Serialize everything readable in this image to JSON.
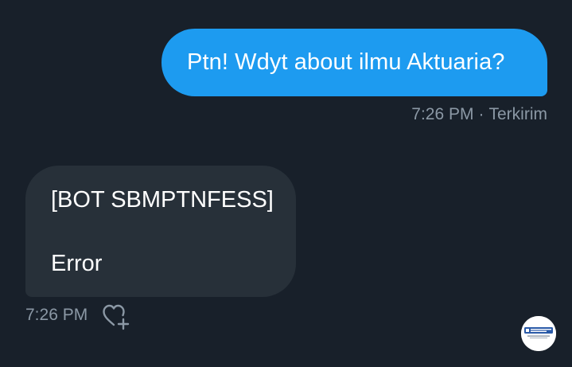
{
  "conversation": {
    "sent_message": {
      "text": "Ptn! Wdyt about ilmu Aktuaria?",
      "time": "7:26 PM",
      "separator": "·",
      "status": "Terkirim"
    },
    "received_message": {
      "line1": "[BOT SBMPTNFESS]",
      "line2": "Error",
      "time": "7:26 PM"
    }
  },
  "icons": {
    "reaction": "heart-plus-icon",
    "avatar": "bot-avatar"
  },
  "colors": {
    "background": "#18202a",
    "sent_bubble": "#1d9bf0",
    "received_bubble": "#273039",
    "meta_text": "#8b98a5",
    "message_text": "#ffffff"
  }
}
